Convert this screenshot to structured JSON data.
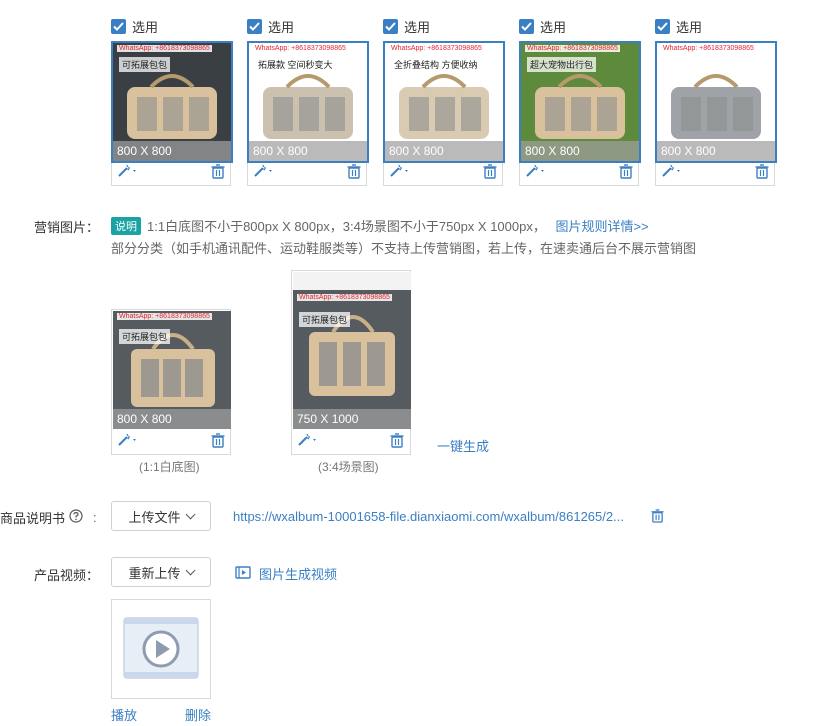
{
  "images": {
    "select_label": "选用",
    "items": [
      {
        "watermark": "WhatsApp: +8618373098865",
        "caption": "可拓展包包",
        "dim": "800 X 800"
      },
      {
        "watermark": "WhatsApp: +8618373098865",
        "caption": "拓展款 空间秒变大",
        "dim": "800 X 800"
      },
      {
        "watermark": "WhatsApp: +8618373098865",
        "caption": "全折叠结构 方便收纳",
        "dim": "800 X 800"
      },
      {
        "watermark": "WhatsApp: +8618373098865",
        "caption": "超大宠物出行包",
        "dim": "800 X 800"
      },
      {
        "watermark": "WhatsApp: +8618373098865",
        "caption": "",
        "dim": "800 X 800"
      }
    ]
  },
  "marketing": {
    "label": "营销图片：",
    "badge": "说明",
    "rule": "1:1白底图不小于800px X 800px，3:4场景图不小于750px X 1000px，",
    "rule_link": "图片规则详情>>",
    "note": "部分分类（如手机通讯配件、运动鞋服类等）不支持上传营销图，若上传，在速卖通后台不展示营销图",
    "square": {
      "watermark": "WhatsApp: +8618373098865",
      "caption": "可拓展包包",
      "dim": "800 X 800",
      "sub": "(1:1白底图)"
    },
    "portrait": {
      "watermark": "WhatsApp: +8618373098865",
      "caption": "可拓展包包",
      "dim": "750 X 1000",
      "sub": "(3:4场景图)"
    },
    "generate_link": "一键生成"
  },
  "manual": {
    "label": "商品说明书",
    "upload_btn": "上传文件",
    "file_url": "https://wxalbum-10001658-file.dianxiaomi.com/wxalbum/861265/2..."
  },
  "video": {
    "label": "产品视频：",
    "reupload_btn": "重新上传",
    "gen_link": "图片生成视频",
    "play": "播放",
    "delete": "删除"
  },
  "colors": {
    "accent": "#3a7fc4",
    "badge": "#1aa3a3"
  }
}
